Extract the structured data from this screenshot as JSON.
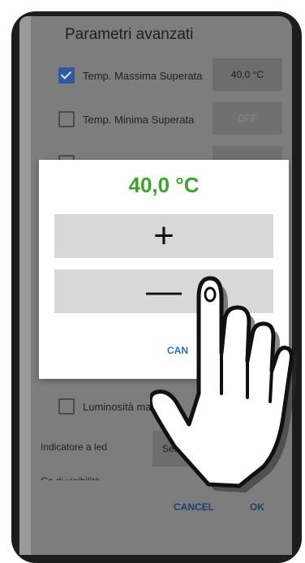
{
  "advanced": {
    "title": "Parametri avanzati",
    "rows": [
      {
        "label": "Temp. Massima Superata",
        "checked": true,
        "value": "40,0 °C"
      },
      {
        "label": "Temp. Minima Superata",
        "checked": false,
        "value": "OFF"
      }
    ],
    "luminosity_label": "Luminosità manuale",
    "led_label": "Indicatore a led",
    "led_value": "Sempre",
    "partial_label": "Co  di  visibilità",
    "cancel": "CANCEL",
    "ok": "OK"
  },
  "dialog": {
    "value": "40,0 °C",
    "plus": "+",
    "minus": "—",
    "footer": "CAN"
  },
  "colors": {
    "accent_green": "#3fa12f",
    "checkbox_blue": "#2f5aa0",
    "button_blue": "#2e6fc0"
  },
  "icons": {
    "pointer": "hand-pointer-icon"
  }
}
